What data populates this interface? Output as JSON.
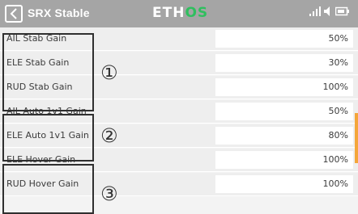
{
  "header": {
    "title": "SRX Stable",
    "logo_main": "ETH",
    "logo_accent": "OS"
  },
  "rows": [
    {
      "label": "AIL Stab Gain",
      "value": "50%"
    },
    {
      "label": "ELE Stab Gain",
      "value": "30%"
    },
    {
      "label": "RUD Stab Gain",
      "value": "100%"
    },
    {
      "label": "AIL Auto 1v1 Gain",
      "value": "50%"
    },
    {
      "label": "ELE Auto 1v1 Gain",
      "value": "80%"
    },
    {
      "label": "ELE Hover Gain",
      "value": "100%"
    },
    {
      "label": "RUD Hover Gain",
      "value": "100%"
    }
  ],
  "group_markers": [
    "①",
    "②",
    "③"
  ],
  "colors": {
    "topbar": "#a5a5a5",
    "os_accent": "#2fbf5e",
    "scroll_thumb": "#f4a63a"
  }
}
